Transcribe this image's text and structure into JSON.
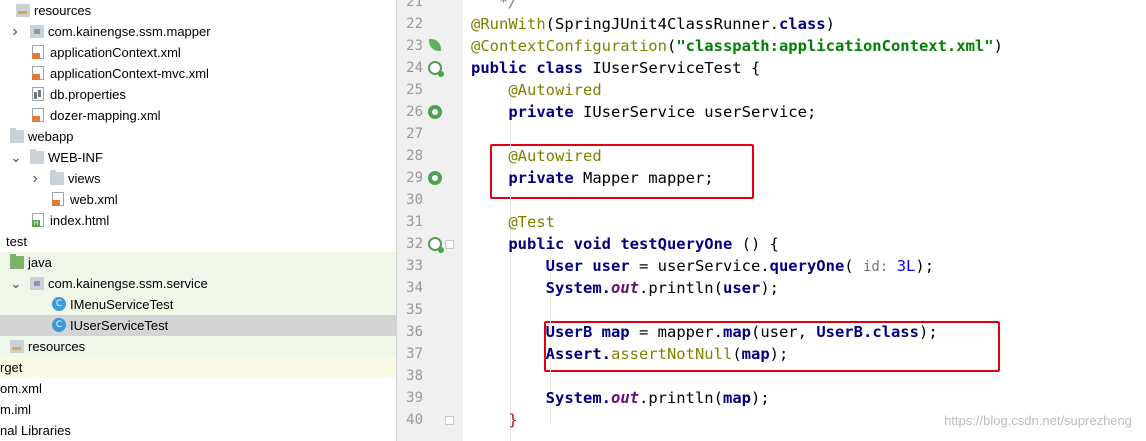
{
  "tree": [
    {
      "label": "resources",
      "icon": "resources-folder-icon",
      "arrow": "",
      "indent": 16,
      "bg": ""
    },
    {
      "label": "com.kainengse.ssm.mapper",
      "icon": "package-icon",
      "arrow": "right",
      "indent": 30,
      "bg": ""
    },
    {
      "label": "applicationContext.xml",
      "icon": "xml-file-icon",
      "arrow": "",
      "indent": 32,
      "bg": ""
    },
    {
      "label": "applicationContext-mvc.xml",
      "icon": "xml-file-icon",
      "arrow": "",
      "indent": 32,
      "bg": ""
    },
    {
      "label": "db.properties",
      "icon": "properties-file-icon",
      "arrow": "",
      "indent": 32,
      "bg": ""
    },
    {
      "label": "dozer-mapping.xml",
      "icon": "xml-file-icon",
      "arrow": "",
      "indent": 32,
      "bg": ""
    },
    {
      "label": "webapp",
      "icon": "folder-icon",
      "arrow": "",
      "indent": 10,
      "bg": ""
    },
    {
      "label": "WEB-INF",
      "icon": "folder-icon",
      "arrow": "down",
      "indent": 30,
      "bg": ""
    },
    {
      "label": "views",
      "icon": "folder-icon",
      "arrow": "right",
      "indent": 50,
      "bg": ""
    },
    {
      "label": "web.xml",
      "icon": "xml-file-icon",
      "arrow": "",
      "indent": 52,
      "bg": ""
    },
    {
      "label": "index.html",
      "icon": "html-file-icon",
      "arrow": "",
      "indent": 32,
      "bg": ""
    },
    {
      "label": "test",
      "icon": "",
      "arrow": "",
      "indent": 6,
      "bg": ""
    },
    {
      "label": "java",
      "icon": "test-source-folder-icon",
      "arrow": "",
      "indent": 10,
      "bg": "green"
    },
    {
      "label": "com.kainengse.ssm.service",
      "icon": "package-icon",
      "arrow": "down",
      "indent": 30,
      "bg": "green"
    },
    {
      "label": "IMenuServiceTest",
      "icon": "class-icon",
      "arrow": "",
      "indent": 52,
      "bg": "green"
    },
    {
      "label": "IUserServiceTest",
      "icon": "class-icon",
      "arrow": "",
      "indent": 52,
      "bg": "sel"
    },
    {
      "label": "resources",
      "icon": "resources-folder-icon",
      "arrow": "",
      "indent": 10,
      "bg": "green"
    },
    {
      "label": "rget",
      "icon": "",
      "arrow": "",
      "indent": 0,
      "bg": "yellow"
    },
    {
      "label": "om.xml",
      "icon": "",
      "arrow": "",
      "indent": 0,
      "bg": ""
    },
    {
      "label": "m.iml",
      "icon": "",
      "arrow": "",
      "indent": 0,
      "bg": ""
    },
    {
      "label": "nal Libraries",
      "icon": "",
      "arrow": "",
      "indent": 0,
      "bg": ""
    }
  ],
  "editor": {
    "line_numbers": [
      "21",
      "22",
      "23",
      "24",
      "25",
      "26",
      "27",
      "28",
      "29",
      "30",
      "31",
      "32",
      "33",
      "34",
      "35",
      "36",
      "37",
      "38",
      "39",
      "40"
    ],
    "lines": [
      [
        {
          "t": "   */",
          "c": "cmt"
        }
      ],
      [
        {
          "t": "@RunWith",
          "c": "an"
        },
        {
          "t": "(SpringJUnit4ClassRunner.",
          "c": ""
        },
        {
          "t": "class",
          "c": "k"
        },
        {
          "t": ")",
          "c": ""
        }
      ],
      [
        {
          "t": "@ContextConfiguration",
          "c": "an"
        },
        {
          "t": "(",
          "c": ""
        },
        {
          "t": "\"classpath:applicationContext.xml\"",
          "c": "str"
        },
        {
          "t": ")",
          "c": ""
        }
      ],
      [
        {
          "t": "public class ",
          "c": "k"
        },
        {
          "t": "IUserServiceTest {",
          "c": ""
        }
      ],
      [
        {
          "t": "    ",
          "c": ""
        },
        {
          "t": "@Autowired",
          "c": "an"
        }
      ],
      [
        {
          "t": "    ",
          "c": ""
        },
        {
          "t": "private ",
          "c": "k"
        },
        {
          "t": "IUserService userService;",
          "c": ""
        }
      ],
      [
        {
          "t": "",
          "c": ""
        }
      ],
      [
        {
          "t": "    ",
          "c": ""
        },
        {
          "t": "@Autowired",
          "c": "an"
        }
      ],
      [
        {
          "t": "    ",
          "c": ""
        },
        {
          "t": "private ",
          "c": "k"
        },
        {
          "t": "Mapper mapper;",
          "c": ""
        }
      ],
      [
        {
          "t": "",
          "c": ""
        }
      ],
      [
        {
          "t": "    ",
          "c": ""
        },
        {
          "t": "@Test",
          "c": "an"
        }
      ],
      [
        {
          "t": "    ",
          "c": ""
        },
        {
          "t": "public void ",
          "c": "k"
        },
        {
          "t": "testQueryOne",
          "c": "k"
        },
        {
          "t": " () {",
          "c": ""
        }
      ],
      [
        {
          "t": "        ",
          "c": ""
        },
        {
          "t": "User ",
          "c": "k"
        },
        {
          "t": "user",
          "c": "k"
        },
        {
          "t": " = userService.",
          "c": ""
        },
        {
          "t": "queryOne",
          "c": "k"
        },
        {
          "t": "( ",
          "c": ""
        },
        {
          "t": "id: ",
          "c": "hint"
        },
        {
          "t": "3L",
          "c": "num"
        },
        {
          "t": ");",
          "c": ""
        }
      ],
      [
        {
          "t": "        ",
          "c": ""
        },
        {
          "t": "System.",
          "c": "k"
        },
        {
          "t": "out",
          "c": "fld"
        },
        {
          "t": ".println(",
          "c": ""
        },
        {
          "t": "user",
          "c": "k"
        },
        {
          "t": ");",
          "c": ""
        }
      ],
      [
        {
          "t": "",
          "c": ""
        }
      ],
      [
        {
          "t": "        ",
          "c": ""
        },
        {
          "t": "UserB map",
          "c": "k"
        },
        {
          "t": " = mapper.",
          "c": ""
        },
        {
          "t": "map",
          "c": "k"
        },
        {
          "t": "(user, ",
          "c": ""
        },
        {
          "t": "UserB.",
          "c": "k"
        },
        {
          "t": "class",
          "c": "k"
        },
        {
          "t": ");",
          "c": ""
        }
      ],
      [
        {
          "t": "        ",
          "c": ""
        },
        {
          "t": "Assert.",
          "c": "k"
        },
        {
          "t": "assertNotNull",
          "c": "an"
        },
        {
          "t": "(",
          "c": ""
        },
        {
          "t": "map",
          "c": "k"
        },
        {
          "t": ");",
          "c": ""
        }
      ],
      [
        {
          "t": "",
          "c": ""
        }
      ],
      [
        {
          "t": "        ",
          "c": ""
        },
        {
          "t": "System.",
          "c": "k"
        },
        {
          "t": "out",
          "c": "fld"
        },
        {
          "t": ".println(",
          "c": ""
        },
        {
          "t": "map",
          "c": "k"
        },
        {
          "t": ");",
          "c": ""
        }
      ],
      [
        {
          "t": "    ",
          "c": ""
        },
        {
          "t": "}",
          "c": "brace"
        }
      ]
    ]
  },
  "watermark": "https://blog.csdn.net/suprezheng"
}
